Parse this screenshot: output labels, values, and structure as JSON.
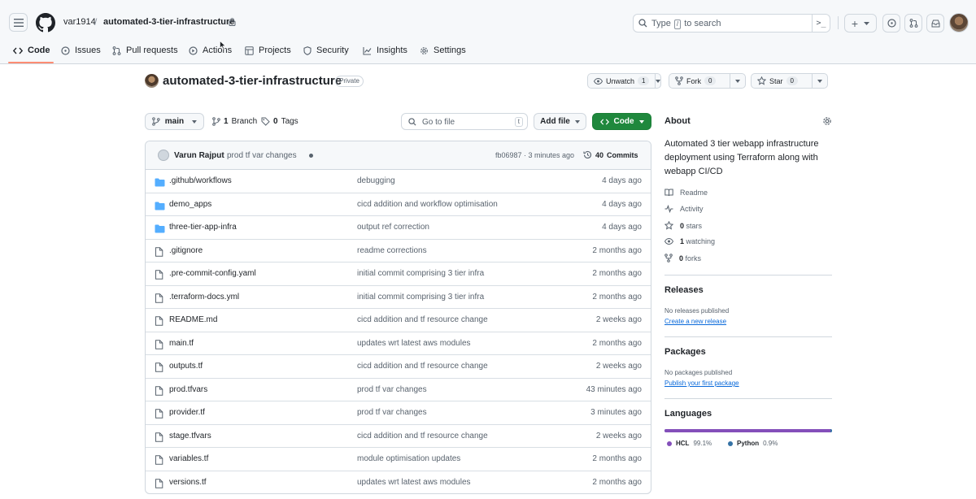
{
  "header": {
    "owner": "var1914",
    "separator": "/",
    "repo": "automated-3-tier-infrastructure",
    "search_prefix": "Type",
    "search_key": "/",
    "search_suffix": "to search"
  },
  "tabs": [
    {
      "label": "Code"
    },
    {
      "label": "Issues"
    },
    {
      "label": "Pull requests"
    },
    {
      "label": "Actions"
    },
    {
      "label": "Projects"
    },
    {
      "label": "Security"
    },
    {
      "label": "Insights"
    },
    {
      "label": "Settings"
    }
  ],
  "repo_header": {
    "title": "automated-3-tier-infrastructure",
    "visibility": "Private",
    "watch_label": "Unwatch",
    "watch_count": "1",
    "fork_label": "Fork",
    "fork_count": "0",
    "star_label": "Star",
    "star_count": "0"
  },
  "actions": {
    "branch": "main",
    "branches_count": "1",
    "branches_label": "Branch",
    "tags_count": "0",
    "tags_label": "Tags",
    "goto_placeholder": "Go to file",
    "goto_key": "t",
    "add_file": "Add file",
    "code": "Code"
  },
  "latest_commit": {
    "author": "Varun Rajput",
    "message": "prod tf var changes",
    "hash_time": "fb06987 · 3 minutes ago",
    "commits_count": "40",
    "commits_label": "Commits"
  },
  "files": [
    {
      "type": "dir",
      "name": ".github/workflows",
      "message": "debugging",
      "time": "4 days ago"
    },
    {
      "type": "dir",
      "name": "demo_apps",
      "message": "cicd addition and workflow optimisation",
      "time": "4 days ago"
    },
    {
      "type": "dir",
      "name": "three-tier-app-infra",
      "message": "output ref correction",
      "time": "4 days ago"
    },
    {
      "type": "file",
      "name": ".gitignore",
      "message": "readme corrections",
      "time": "2 months ago"
    },
    {
      "type": "file",
      "name": ".pre-commit-config.yaml",
      "message": "initial commit comprising 3 tier infra",
      "time": "2 months ago"
    },
    {
      "type": "file",
      "name": ".terraform-docs.yml",
      "message": "initial commit comprising 3 tier infra",
      "time": "2 months ago"
    },
    {
      "type": "file",
      "name": "README.md",
      "message": "cicd addition and tf resource change",
      "time": "2 weeks ago"
    },
    {
      "type": "file",
      "name": "main.tf",
      "message": "updates wrt latest aws modules",
      "time": "2 months ago"
    },
    {
      "type": "file",
      "name": "outputs.tf",
      "message": "cicd addition and tf resource change",
      "time": "2 weeks ago"
    },
    {
      "type": "file",
      "name": "prod.tfvars",
      "message": "prod tf var changes",
      "time": "43 minutes ago"
    },
    {
      "type": "file",
      "name": "provider.tf",
      "message": "prod tf var changes",
      "time": "3 minutes ago"
    },
    {
      "type": "file",
      "name": "stage.tfvars",
      "message": "cicd addition and tf resource change",
      "time": "2 weeks ago"
    },
    {
      "type": "file",
      "name": "variables.tf",
      "message": "module optimisation updates",
      "time": "2 months ago"
    },
    {
      "type": "file",
      "name": "versions.tf",
      "message": "updates wrt latest aws modules",
      "time": "2 months ago"
    }
  ],
  "sidebar": {
    "about_title": "About",
    "description": "Automated 3 tier webapp infrastructure deployment using Terraform along with webapp CI/CD",
    "readme": "Readme",
    "activity": "Activity",
    "stars_count": "0",
    "stars_label": "stars",
    "watching_count": "1",
    "watching_label": "watching",
    "forks_count": "0",
    "forks_label": "forks",
    "releases_title": "Releases",
    "no_releases": "No releases published",
    "create_release": "Create a new release",
    "packages_title": "Packages",
    "no_packages": "No packages published",
    "publish_package": "Publish your first package",
    "languages_title": "Languages",
    "languages": [
      {
        "name": "HCL",
        "percent": "99.1%",
        "color": "#844fba"
      },
      {
        "name": "Python",
        "percent": "0.9%",
        "color": "#3572a5"
      }
    ]
  }
}
